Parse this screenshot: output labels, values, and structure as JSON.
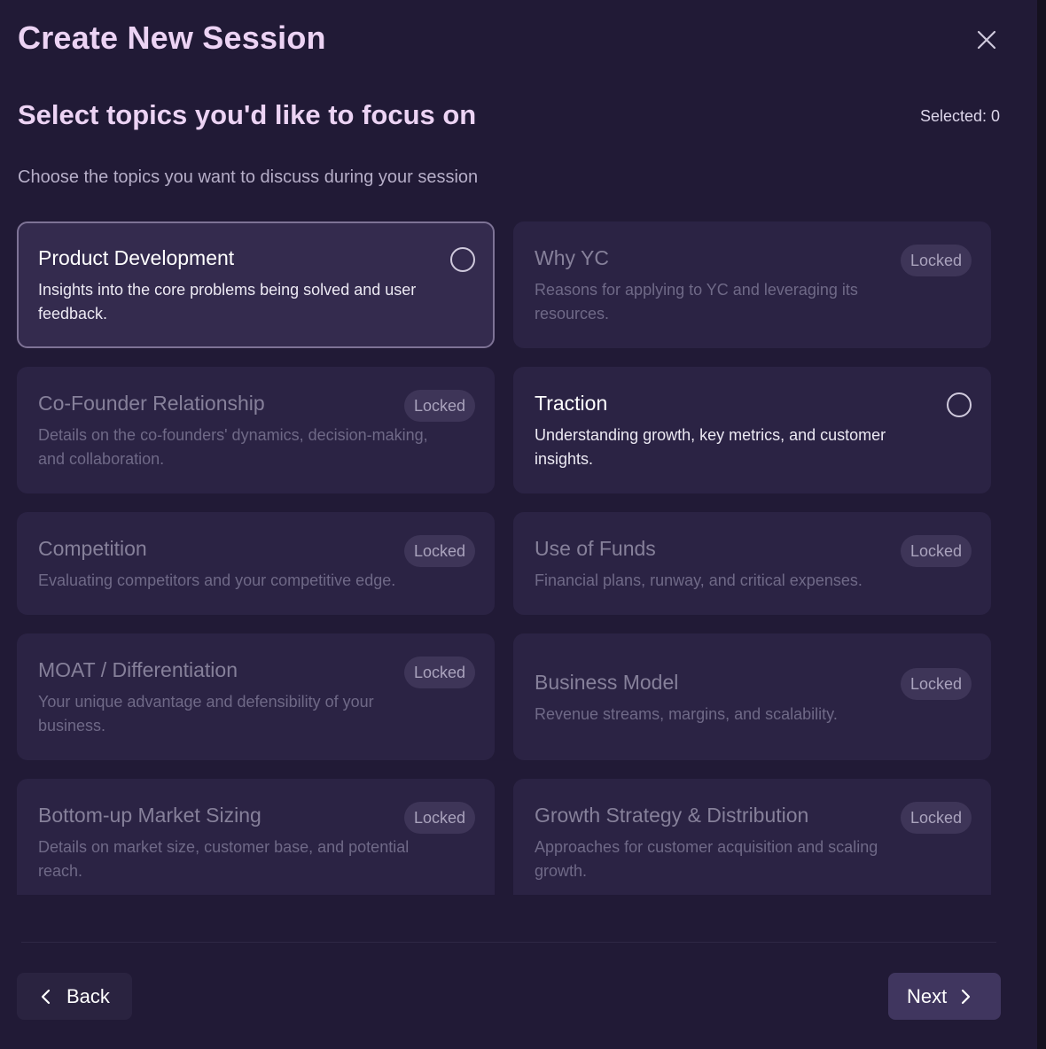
{
  "modal": {
    "title": "Create New Session",
    "subtitle": "Select topics you'd like to focus on",
    "selected_count": "Selected: 0",
    "description": "Choose the topics you want to discuss during your session"
  },
  "topics": [
    {
      "title": "Product Development",
      "desc": "Insights into the core problems being solved and user feedback.",
      "state": "available",
      "highlighted": true
    },
    {
      "title": "Why YC",
      "desc": "Reasons for applying to YC and leveraging its resources.",
      "state": "locked",
      "badge": "Locked"
    },
    {
      "title": "Co-Founder Relationship",
      "desc": "Details on the co-founders' dynamics, decision-making, and collaboration.",
      "state": "locked",
      "badge": "Locked"
    },
    {
      "title": "Traction",
      "desc": "Understanding growth, key metrics, and customer insights.",
      "state": "available"
    },
    {
      "title": "Competition",
      "desc": "Evaluating competitors and your competitive edge.",
      "state": "locked",
      "badge": "Locked"
    },
    {
      "title": "Use of Funds",
      "desc": "Financial plans, runway, and critical expenses.",
      "state": "locked",
      "badge": "Locked"
    },
    {
      "title": "MOAT / Differentiation",
      "desc": "Your unique advantage and defensibility of your business.",
      "state": "locked",
      "badge": "Locked"
    },
    {
      "title": "Business Model",
      "desc": "Revenue streams, margins, and scalability.",
      "state": "locked",
      "badge": "Locked"
    },
    {
      "title": "Bottom-up Market Sizing",
      "desc": "Details on market size, customer base, and potential reach.",
      "state": "locked",
      "badge": "Locked"
    },
    {
      "title": "Growth Strategy & Distribution",
      "desc": "Approaches for customer acquisition and scaling growth.",
      "state": "locked",
      "badge": "Locked"
    }
  ],
  "footer": {
    "back_label": "Back",
    "next_label": "Next"
  },
  "icons": {
    "close": "close-icon",
    "back": "chevron-left-icon",
    "next": "chevron-right-icon",
    "select": "radio-icon"
  },
  "colors": {
    "background": "#211a36",
    "heading": "#ecd3f4",
    "card": "#2b2344",
    "card_active": "#342b4e",
    "badge": "#3e3558",
    "next_button": "#40365f"
  }
}
